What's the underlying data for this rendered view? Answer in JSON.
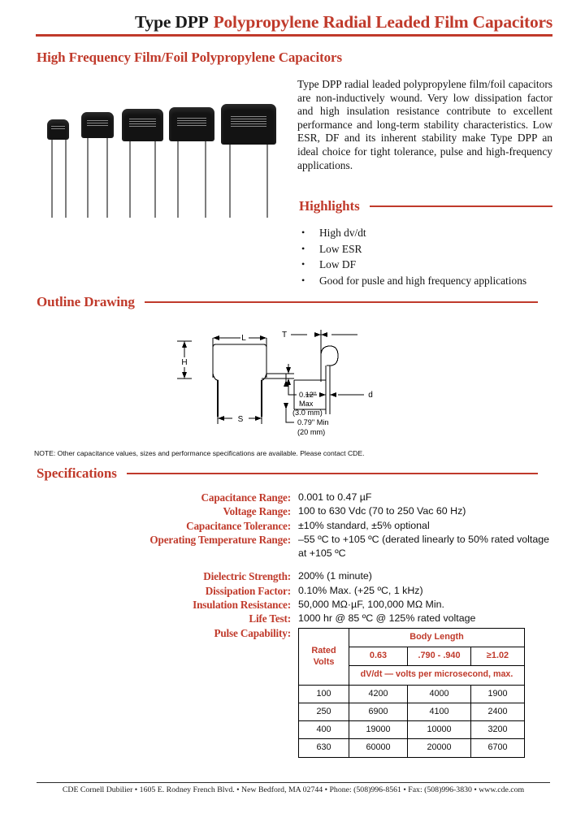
{
  "colors": {
    "accent_red": "#C03A2B",
    "text_black": "#111111",
    "capacitor_body": "#131313"
  },
  "header": {
    "title_type": "Type DPP",
    "title_main": "Polypropylene Radial Leaded Film Capacitors",
    "subtitle": "High Frequency Film/Foil Polypropylene Capacitors"
  },
  "intro": {
    "paragraph": "Type DPP radial leaded polypropylene film/foil capacitors are non-inductively wound. Very low dissipation factor and high insulation resistance contribute to excellent performance and long-term stability characteristics.  Low ESR, DF and its inherent stability make Type DPP an ideal choice for tight tolerance, pulse and high-frequency applications."
  },
  "highlights": {
    "heading": "Highlights",
    "bullet_glyph": "•",
    "items": [
      "High dv/dt",
      "Low ESR",
      "Low DF",
      "Good for pusle and high frequency applications"
    ]
  },
  "outline": {
    "heading": "Outline Drawing",
    "labels": {
      "L": "L",
      "H": "H",
      "S": "S",
      "T": "T",
      "d": "d",
      "max_in": "0.12\"",
      "max_word": "Max",
      "max_mm": "(3.0 mm)",
      "min_in": "0.79\" Min",
      "min_mm": "(20 mm)"
    }
  },
  "note": {
    "text": "NOTE:  Other capacitance values, sizes and performance specifications are available.  Please contact CDE."
  },
  "specifications": {
    "heading": "Specifications",
    "rows": [
      {
        "label": "Capacitance Range:",
        "value": "0.001 to 0.47 µF"
      },
      {
        "label": "Voltage Range:",
        "value": "100 to 630 Vdc (70 to 250 Vac 60 Hz)"
      },
      {
        "label": "Capacitance Tolerance:",
        "value": "±10% standard, ±5% optional"
      },
      {
        "label": "Operating Temperature Range:",
        "value": "–55 ºC to +105 ºC (derated linearly to 50% rated voltage at +105 ºC"
      },
      {
        "label": "Dielectric Strength:",
        "value": "200% (1 minute)"
      },
      {
        "label": "Dissipation Factor:",
        "value": "0.10% Max. (+25 ºC, 1 kHz)"
      },
      {
        "label": "Insulation Resistance:",
        "value": "50,000 MΩ·µF, 100,000 MΩ Min."
      },
      {
        "label": "Life Test:",
        "value": "1000 hr @ 85 ºC @ 125% rated voltage"
      }
    ],
    "pulse_label": "Pulse Capability:"
  },
  "pulse_table": {
    "rated_volts_header": "Rated\nVolts",
    "rated_header_line1": "Rated",
    "rated_header_line2": "Volts",
    "body_length_header": "Body Length",
    "body_length_cols": [
      "0.63",
      ".790 - .940",
      "≥1.02"
    ],
    "dvdt_header": "dV/dt — volts per microsecond, max.",
    "rows": [
      {
        "volts": "100",
        "values": [
          "4200",
          "4000",
          "1900"
        ]
      },
      {
        "volts": "250",
        "values": [
          "6900",
          "4100",
          "2400"
        ]
      },
      {
        "volts": "400",
        "values": [
          "19000",
          "10000",
          "3200"
        ]
      },
      {
        "volts": "630",
        "values": [
          "60000",
          "20000",
          "6700"
        ]
      }
    ]
  },
  "footer": {
    "text": "CDE Cornell Dubilier • 1605 E. Rodney French Blvd. • New Bedford, MA 02744 • Phone: (508)996-8561 • Fax: (508)996-3830 • www.cde.com"
  }
}
